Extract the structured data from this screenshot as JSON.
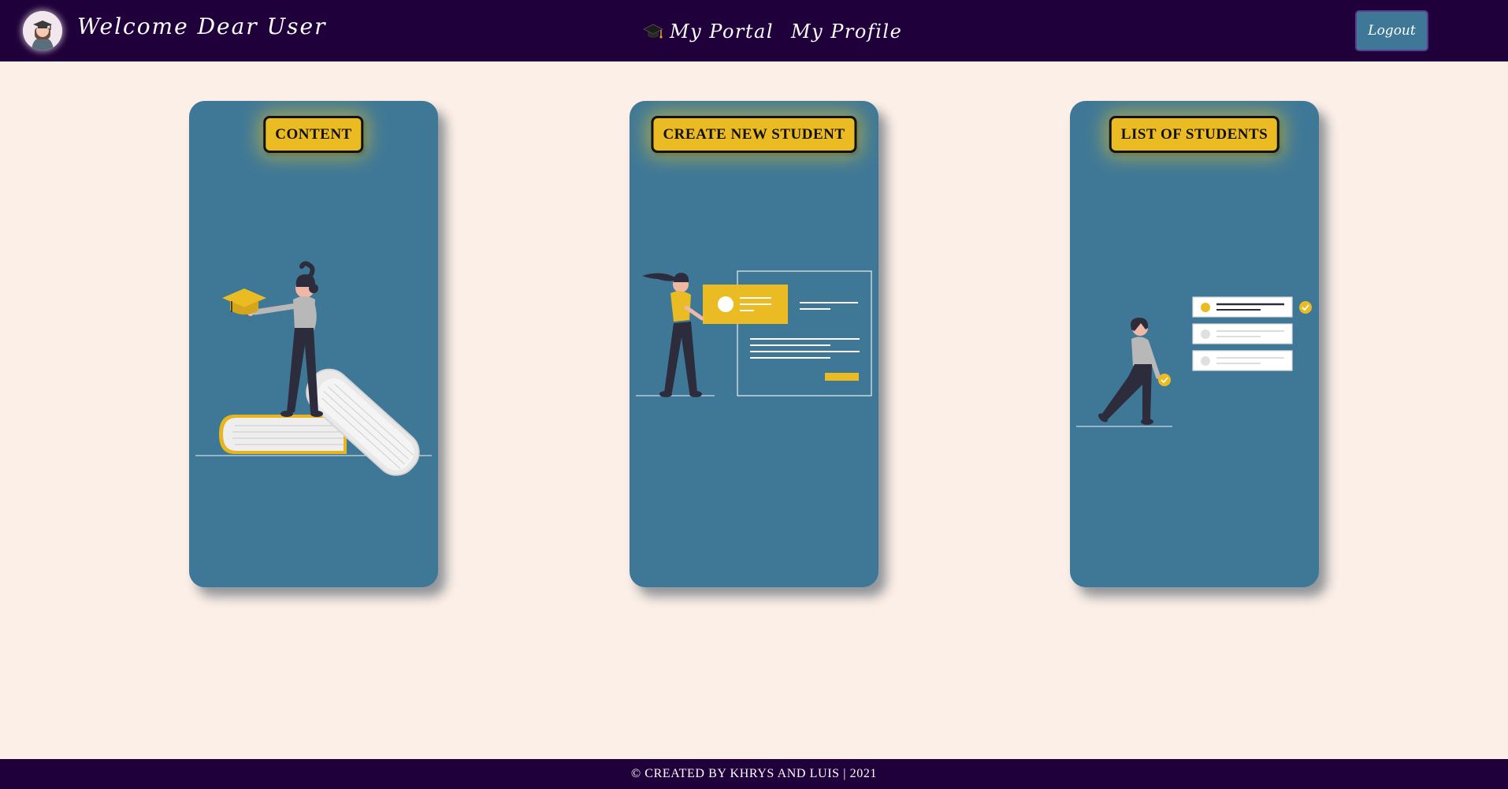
{
  "header": {
    "welcome_text": "Welcome Dear User",
    "avatar_icon": "graduate-avatar-icon",
    "nav": {
      "portal_icon": "graduation-cap-icon",
      "portal_label": "My Portal",
      "profile_label": "My Profile"
    },
    "logout_label": "Logout"
  },
  "cards": [
    {
      "label": "CONTENT",
      "illustration": "woman-on-books-illustration"
    },
    {
      "label": "CREATE NEW STUDENT",
      "illustration": "woman-with-id-card-illustration"
    },
    {
      "label": "LIST OF STUDENTS",
      "illustration": "woman-with-checklist-illustration"
    }
  ],
  "footer": {
    "text": "© CREATED BY KHRYS AND LUIS | 2021"
  },
  "colors": {
    "navbar": "#20003a",
    "background": "#fbefe7",
    "card": "#3f7897",
    "accent": "#ebbb24"
  }
}
